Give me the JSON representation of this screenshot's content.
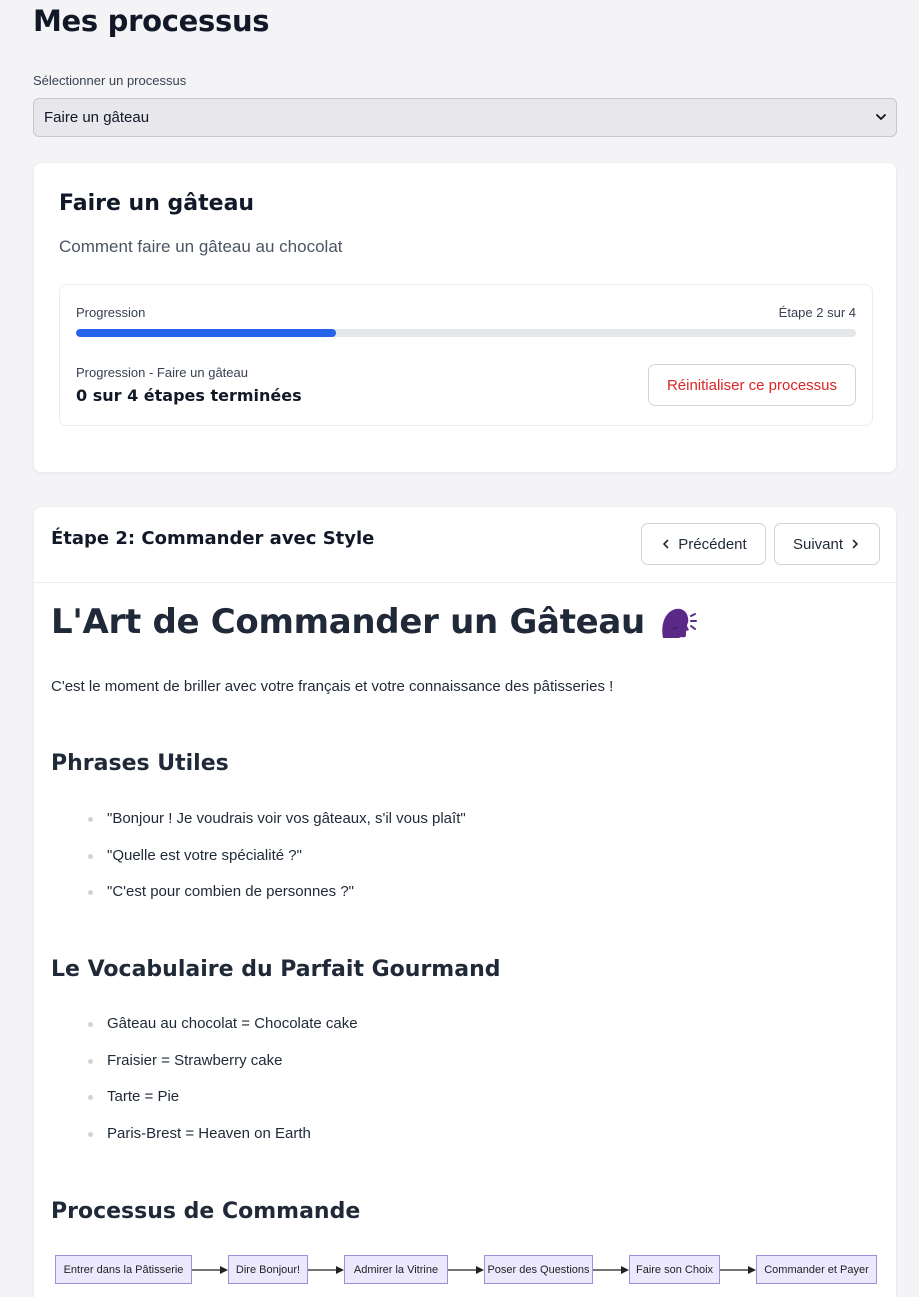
{
  "header": {
    "title": "Mes processus"
  },
  "selector": {
    "label": "Sélectionner un processus",
    "value": "Faire un gâteau"
  },
  "process": {
    "title": "Faire un gâteau",
    "description": "Comment faire un gâteau au chocolat",
    "progress": {
      "label": "Progression",
      "step_text": "Étape 2 sur 4",
      "fraction": 0.333,
      "subtitle": "Progression - Faire un gâteau",
      "completed_text": "0 sur 4 étapes terminées",
      "reset_label": "Réinitialiser ce processus"
    }
  },
  "step": {
    "title": "Étape 2: Commander avec Style",
    "prev_label": "Précédent",
    "next_label": "Suivant"
  },
  "article": {
    "h1": "L'Art de Commander un Gâteau",
    "intro": "C'est le moment de briller avec votre français et votre connaissance des pâtisseries !",
    "phrases_title": "Phrases Utiles",
    "phrases": [
      "\"Bonjour ! Je voudrais voir vos gâteaux, s'il vous plaît\"",
      "\"Quelle est votre spécialité ?\"",
      "\"C'est pour combien de personnes ?\""
    ],
    "vocab_title": "Le Vocabulaire du Parfait Gourmand",
    "vocab": [
      "Gâteau au chocolat = Chocolate cake",
      "Fraisier = Strawberry cake",
      "Tarte = Pie",
      "Paris-Brest = Heaven on Earth"
    ],
    "flow_title": "Processus de Commande",
    "flow": [
      "Entrer dans la Pâtisserie",
      "Dire Bonjour!",
      "Admirer la Vitrine",
      "Poser des Questions",
      "Faire son Choix",
      "Commander et Payer"
    ]
  },
  "colors": {
    "accent": "#2563eb",
    "danger": "#dc2626",
    "flow_node_fill": "#ece9ff",
    "flow_node_border": "#9f8fdb"
  },
  "icons": {
    "select": "chevron-down-icon",
    "prev": "chevron-left-icon",
    "next": "chevron-right-icon",
    "heading": "speaking-head-icon"
  }
}
